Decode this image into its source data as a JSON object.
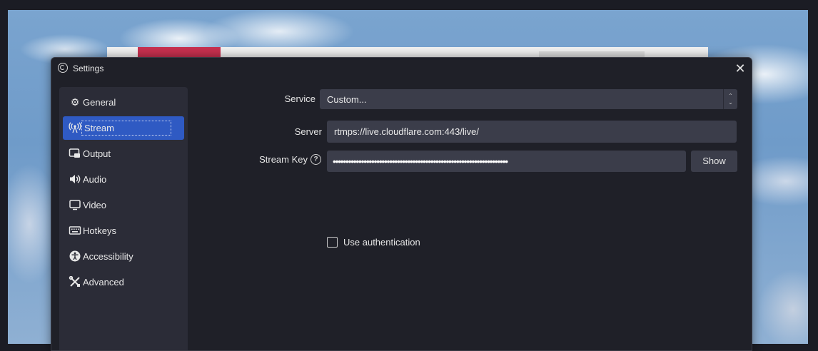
{
  "window": {
    "title": "Settings",
    "close_symbol": "✕"
  },
  "sidebar": {
    "items": [
      {
        "label": "General",
        "icon": "gear-icon",
        "glyph": "⚙",
        "active": false
      },
      {
        "label": "Stream",
        "icon": "antenna-icon",
        "glyph": "📡",
        "active": true
      },
      {
        "label": "Output",
        "icon": "output-icon",
        "glyph": "▣",
        "active": false
      },
      {
        "label": "Audio",
        "icon": "speaker-icon",
        "glyph": "🔊",
        "active": false
      },
      {
        "label": "Video",
        "icon": "monitor-icon",
        "glyph": "▭",
        "active": false
      },
      {
        "label": "Hotkeys",
        "icon": "keyboard-icon",
        "glyph": "⌨",
        "active": false
      },
      {
        "label": "Accessibility",
        "icon": "accessibility-icon",
        "glyph": "♿",
        "active": false
      },
      {
        "label": "Advanced",
        "icon": "tools-icon",
        "glyph": "✂",
        "active": false
      }
    ]
  },
  "stream": {
    "service_label": "Service",
    "service_value": "Custom...",
    "server_label": "Server",
    "server_value": "rtmps://live.cloudflare.com:443/live/",
    "key_label": "Stream Key",
    "key_value": "••••••••••••••••••••••••••••••••••••••••••••••••••••••••••••••••••••",
    "help_glyph": "?",
    "show_label": "Show",
    "auth_label": "Use authentication",
    "auth_checked": false
  },
  "colors": {
    "accent": "#2f5ac3",
    "dialog_bg": "#1f2028",
    "sidebar_bg": "#2b2c37",
    "field_bg": "#3b3d4a"
  }
}
